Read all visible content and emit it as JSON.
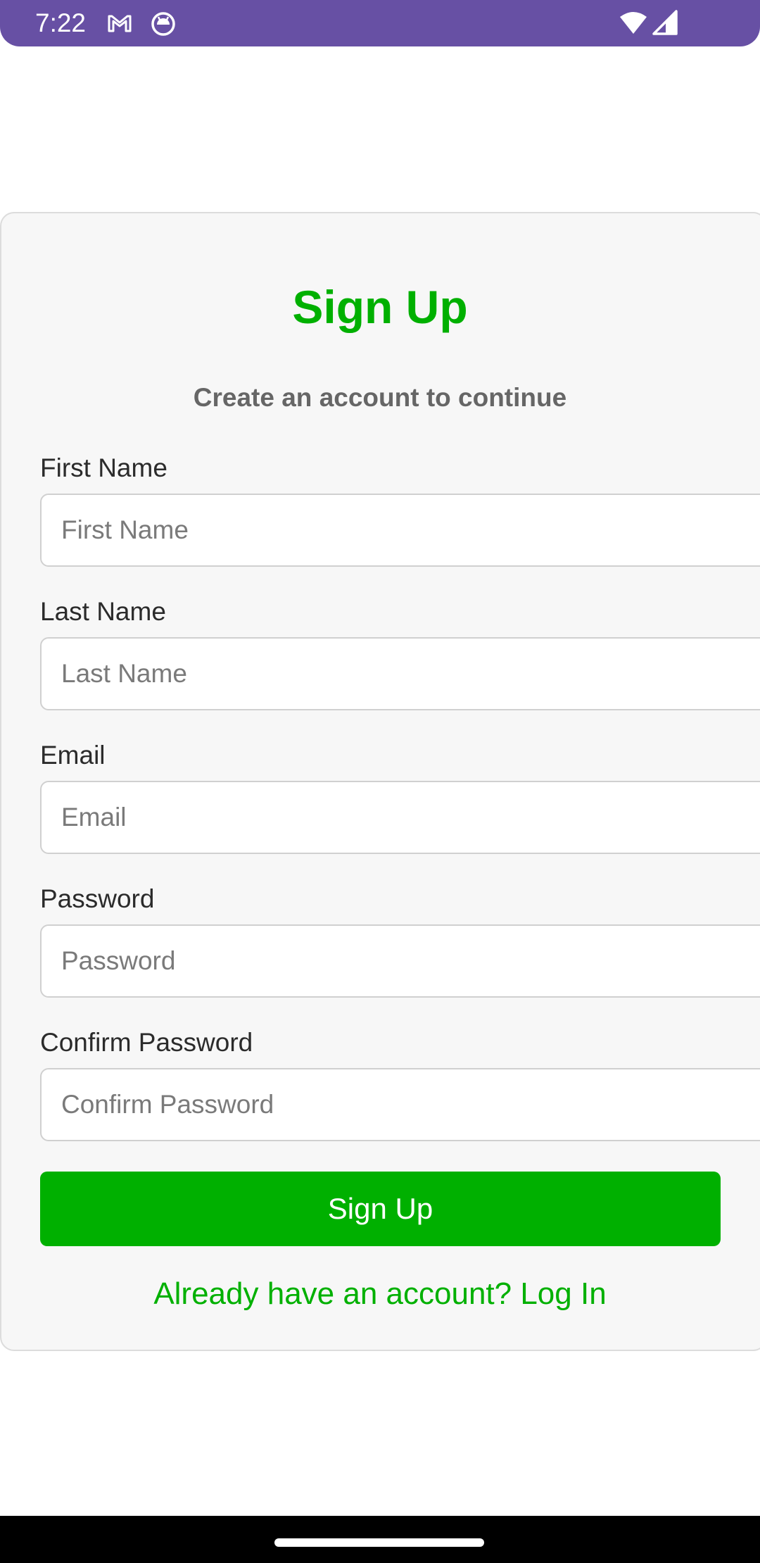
{
  "status_bar": {
    "time": "7:22",
    "background": "#6750A4",
    "icons": [
      "gmail-icon",
      "android-notification-icon",
      "wifi-icon",
      "cellular-signal-icon"
    ]
  },
  "signup": {
    "title": "Sign Up",
    "subtitle": "Create an account to continue",
    "accent_color": "#00B000",
    "fields": [
      {
        "label": "First Name",
        "placeholder": "First Name",
        "value": ""
      },
      {
        "label": "Last Name",
        "placeholder": "Last Name",
        "value": ""
      },
      {
        "label": "Email",
        "placeholder": "Email",
        "value": ""
      },
      {
        "label": "Password",
        "placeholder": "Password",
        "value": ""
      },
      {
        "label": "Confirm Password",
        "placeholder": "Confirm Password",
        "value": ""
      }
    ],
    "button_label": "Sign Up",
    "login_link": "Already have an account? Log In"
  }
}
